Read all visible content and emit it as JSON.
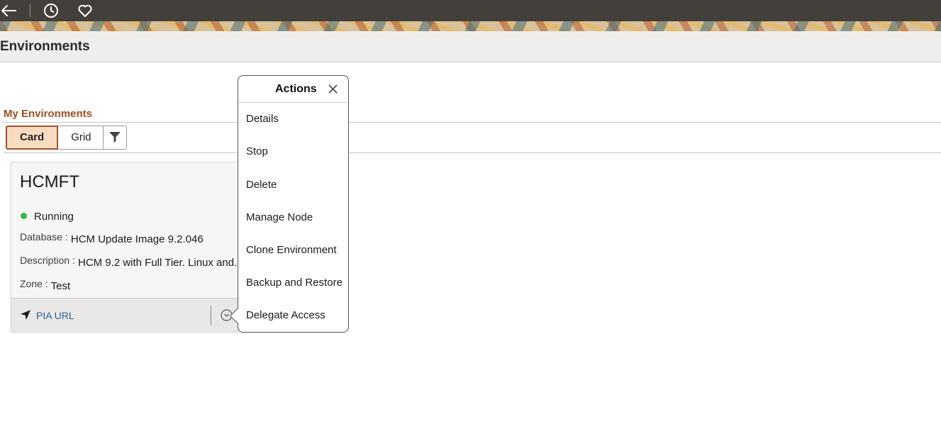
{
  "page": {
    "title": "Environments"
  },
  "nav": {
    "icons": [
      "back-arrow-icon",
      "recent-history-icon",
      "favorites-heart-icon"
    ]
  },
  "section": {
    "title": "My Environments"
  },
  "view_toggle": {
    "card_label": "Card",
    "grid_label": "Grid",
    "selected": "Card"
  },
  "filter": {
    "icon": "filter-funnel-icon"
  },
  "card": {
    "name": "HCMFT",
    "status": "Running",
    "status_color": "#3cb449",
    "database_label": "Database :",
    "database_value": "HCM Update Image 9.2.046",
    "description_label": "Description :",
    "description_value": "HCM 9.2 with Full Tier. Linux and...",
    "zone_label": "Zone :",
    "zone_value": "Test",
    "pia_label": "PIA URL"
  },
  "actions_popup": {
    "title": "Actions",
    "items": [
      "Details",
      "Stop",
      "Delete",
      "Manage Node",
      "Clone Environment",
      "Backup and Restore",
      "Delegate Access"
    ]
  },
  "colors": {
    "accent": "#9b4f25",
    "topbar": "#433f3b",
    "link": "#2a5d99"
  }
}
